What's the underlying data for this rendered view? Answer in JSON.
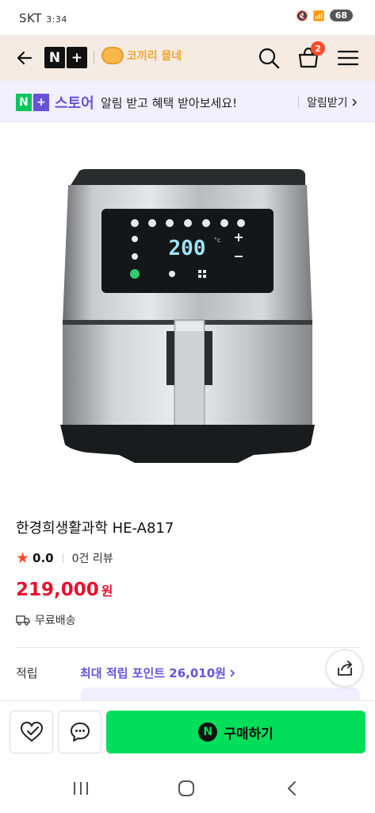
{
  "status_bar": {
    "carrier": "SKT",
    "time": "3:34",
    "battery": "68"
  },
  "header": {
    "logo_left": "N",
    "logo_right": "+",
    "store_name": "코끼리 몰네"
  },
  "cart": {
    "count": "2"
  },
  "notice": {
    "brand_n": "N",
    "brand_plus": "+",
    "brand_text": "스토어",
    "message": "알림 받고 혜택 받아보세요!",
    "link_label": "알림받기"
  },
  "product": {
    "title": "한경희생활과학 HE-A817",
    "rating": "0.0",
    "reviews": "0건 리뷰",
    "price": "219,000",
    "price_unit": "원",
    "shipping": "무료배송",
    "display_temp": "200",
    "display_unit": "°c"
  },
  "points": {
    "label": "적립",
    "value": "최대 적립 포인트 26,010원"
  },
  "action": {
    "buy_icon": "N",
    "buy_label": "구매하기"
  },
  "colors": {
    "accent_purple": "#6653d8",
    "naver_green": "#03c75a",
    "buy_green": "#00de5a",
    "price_red": "#e8102e",
    "header_bg": "#f5ebe3",
    "notice_bg": "#f2f0ff"
  }
}
